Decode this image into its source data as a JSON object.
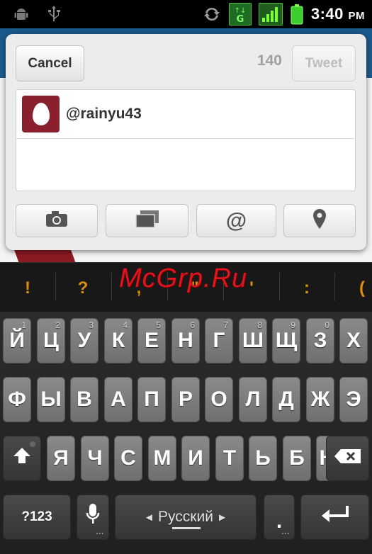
{
  "statusbar": {
    "icons": [
      "android-debug-icon",
      "usb-icon",
      "sync-icon",
      "network-3g-icon",
      "signal-icon",
      "battery-icon"
    ],
    "time": "3:40",
    "ampm": "PM"
  },
  "dialog": {
    "cancel_label": "Cancel",
    "counter": "140",
    "tweet_label": "Tweet",
    "username": "@rainyu43",
    "actions": [
      "camera-icon",
      "gallery-icon",
      "at-sign-icon",
      "location-pin-icon"
    ],
    "at_glyph": "@"
  },
  "suggestions": [
    "!",
    "?",
    ",",
    "\"",
    "'",
    ":",
    "("
  ],
  "watermark": "McGrp.Ru",
  "keyboard": {
    "row1": [
      {
        "label": "Й",
        "num": "1"
      },
      {
        "label": "Ц",
        "num": "2"
      },
      {
        "label": "У",
        "num": "3"
      },
      {
        "label": "К",
        "num": "4"
      },
      {
        "label": "Е",
        "num": "5"
      },
      {
        "label": "Н",
        "num": "6"
      },
      {
        "label": "Г",
        "num": "7"
      },
      {
        "label": "Ш",
        "num": "8"
      },
      {
        "label": "Щ",
        "num": "9"
      },
      {
        "label": "З",
        "num": "0"
      },
      {
        "label": "Х",
        "num": ""
      }
    ],
    "row2": [
      "Ф",
      "Ы",
      "В",
      "А",
      "П",
      "Р",
      "О",
      "Л",
      "Д",
      "Ж",
      "Э"
    ],
    "row3": [
      "Я",
      "Ч",
      "С",
      "М",
      "И",
      "Т",
      "Ь",
      "Б",
      "Ю"
    ],
    "symbols_label": "?123",
    "space_label": "Русский",
    "period_label": ".",
    "colors": {
      "key": "#7d7d7d",
      "key_dark": "#3f3f3f",
      "accent": "#e08f0b"
    }
  }
}
